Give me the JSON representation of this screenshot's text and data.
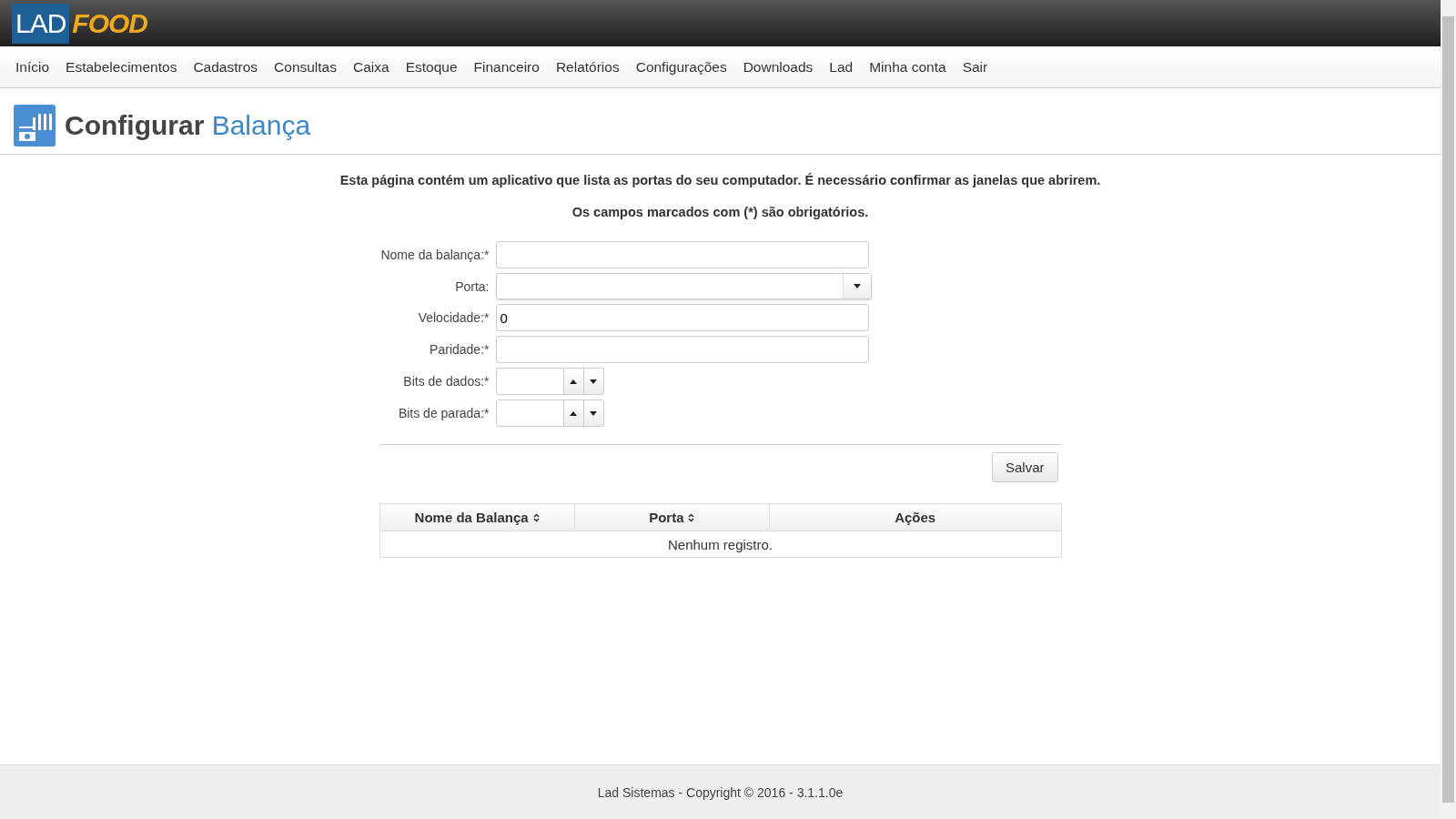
{
  "logo": {
    "part_1": "LAD",
    "part_2": "FOOD"
  },
  "nav": [
    "Início",
    "Estabelecimentos",
    "Cadastros",
    "Consultas",
    "Caixa",
    "Estoque",
    "Financeiro",
    "Relatórios",
    "Configurações",
    "Downloads",
    "Lad",
    "Minha conta",
    "Sair"
  ],
  "page_title": {
    "verb": "Configurar",
    "object": "Balança"
  },
  "intro": "Esta página contém um aplicativo que lista as portas do seu computador. É necessário confirmar as janelas que abrirem.",
  "required_note": "Os campos marcados com (*) são obrigatórios.",
  "fields": [
    {
      "label": "Nome da balança:*",
      "kind": "text"
    },
    {
      "label": "Porta:",
      "kind": "select"
    },
    {
      "label": "Velocidade:*",
      "kind": "text",
      "value": "0"
    },
    {
      "label": "Paridade:*",
      "kind": "text"
    },
    {
      "label": "Bits de dados:*",
      "kind": "spinner"
    },
    {
      "label": "Bits de parada:*",
      "kind": "spinner"
    }
  ],
  "save_button": "Salvar",
  "table": {
    "columns": [
      {
        "label": "Nome da Balança",
        "sortable": true
      },
      {
        "label": "Porta",
        "sortable": true
      },
      {
        "label": "Ações",
        "sortable": false
      }
    ],
    "empty_message": "Nenhum registro."
  },
  "footer": "Lad Sistemas - Copyright © 2016 - 3.1.1.0e"
}
